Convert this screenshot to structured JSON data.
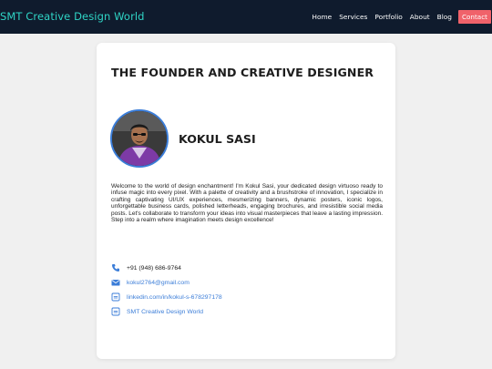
{
  "nav": {
    "brand": "SMT Creative Design World",
    "links": [
      "Home",
      "Services",
      "Portfolio",
      "About",
      "Blog"
    ],
    "cta": "Contact"
  },
  "card": {
    "title": "THE FOUNDER AND CREATIVE DESIGNER",
    "name": "KOKUL SASI",
    "bio": "Welcome to the world of design enchantment! I'm Kokul Sasi, your dedicated design virtuoso ready to infuse magic into every pixel. With a palette of creativity and a brushstroke of innovation, I specialize in crafting captivating UI/UX experiences, mesmerizing banners, dynamic posters, iconic logos, unforgettable business cards, polished letterheads, engaging brochures, and irresistible social media posts. Let's collaborate to transform your ideas into visual masterpieces that leave a lasting impression. Step into a realm where imagination meets design excellence!"
  },
  "contacts": {
    "phone": "+91 (948) 686-9764",
    "email": "kokul2764@gmail.com",
    "linkedin": "linkedin.com/in/kokul-s-678297178",
    "website": "SMT Creative Design World"
  },
  "icons": {
    "phone": "phone-icon",
    "email": "envelope-icon",
    "linkedin": "linkedin-icon",
    "website": "globe-icon"
  },
  "colors": {
    "navbar": "#0f1b2d",
    "brand": "#2fd4c5",
    "cta": "#f0626a",
    "accent": "#3b7dd8",
    "page_bg": "#f0f0f0"
  }
}
